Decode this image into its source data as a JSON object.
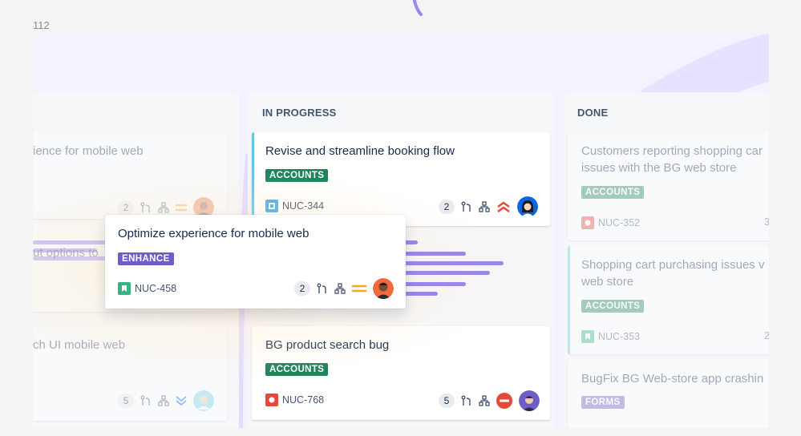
{
  "page_number": "112",
  "colors": {
    "accent_blue": "#0c66e4",
    "lozenge_green": "#1f845a",
    "lozenge_purple": "#6e5dc6",
    "priority_orange": "#f5a623",
    "priority_red": "#e5493a",
    "speedline": "#9b87ea"
  },
  "columns": {
    "in_progress": "IN PROGRESS",
    "done": "DONE"
  },
  "left_column": {
    "card1_title": "ience for mobile web",
    "card1_count": "2",
    "card2_partial": "ut options to",
    "card3_title": "ch UI mobile web",
    "card3_count": "5"
  },
  "in_progress_cards": [
    {
      "title": "Revise and streamline booking flow",
      "label": "ACCOUNTS",
      "key": "NUC-344",
      "count": "2",
      "type_icon": "subtask-icon",
      "priority": "highest-priority-icon"
    },
    {
      "title": "BG product search bug",
      "label": "ACCOUNTS",
      "key": "NUC-768",
      "count": "5",
      "type_icon": "bug-icon",
      "priority": "blocker-priority-icon"
    }
  ],
  "done_cards": [
    {
      "title_line1": "Customers reporting shopping car",
      "title_line2": "issues with the BG web store",
      "label": "ACCOUNTS",
      "key": "NUC-352",
      "count": "3"
    },
    {
      "title_line1": "Shopping cart purchasing issues v",
      "title_line2": "web store",
      "label": "ACCOUNTS",
      "key": "NUC-353",
      "count": "2"
    },
    {
      "title_line1": "BugFix BG Web-store app crashin",
      "label": "FORMS"
    }
  ],
  "dragged_card": {
    "title": "Optimize experience for mobile web",
    "label": "ENHANCE",
    "key": "NUC-458",
    "count": "2",
    "type_icon": "story-icon",
    "priority": "medium-priority-icon"
  }
}
